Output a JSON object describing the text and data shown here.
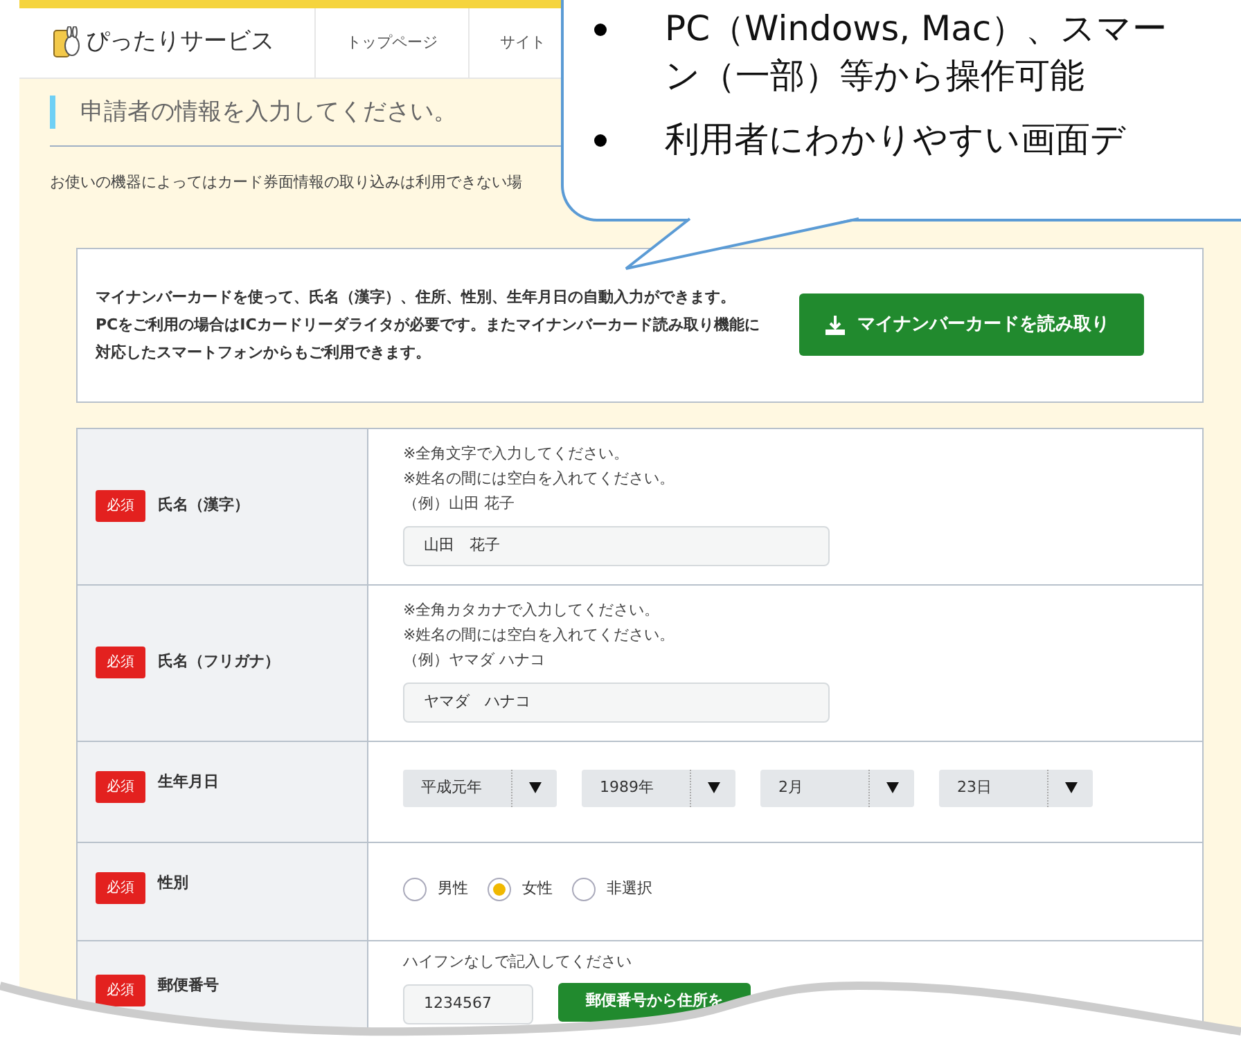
{
  "header": {
    "logo": "ぴったりサービス",
    "nav": [
      "トップページ",
      "サイト"
    ]
  },
  "section_title": "申請者の情報を入力してください。",
  "notice": "お使いの機器によってはカード券面情報の取り込みは利用できない場",
  "card_reader": {
    "paragraphs": [
      "マイナンバーカードを使って、氏名（漢字）、住所、性別、生年月日の自動入力ができます。",
      "PCをご利用の場合はICカードリーダライタが必要です。またマイナンバーカード読み取り機能に対応したスマートフォンからもご利用できます。"
    ],
    "button": "マイナンバーカードを読み取り"
  },
  "form": {
    "rows": [
      {
        "kind": "text",
        "badge": "必須",
        "label": "氏名（漢字）",
        "hints": [
          "※全角文字で入力してください。",
          "※姓名の間には空白を入れてください。",
          "（例）山田 花子"
        ],
        "value": "山田　花子"
      },
      {
        "kind": "text",
        "badge": "必須",
        "label": "氏名（フリガナ）",
        "hints": [
          "※全角カタカナで入力してください。",
          "※姓名の間には空白を入れてください。",
          "（例）ヤマダ ハナコ"
        ],
        "value": "ヤマダ　ハナコ"
      },
      {
        "kind": "date",
        "badge": "必須",
        "label": "生年月日",
        "selects": [
          "平成元年",
          "1989年",
          "2月",
          "23日"
        ]
      },
      {
        "kind": "radio",
        "badge": "必須",
        "label": "性別",
        "options": [
          {
            "label": "男性",
            "selected": false
          },
          {
            "label": "女性",
            "selected": true
          },
          {
            "label": "非選択",
            "selected": false
          }
        ]
      },
      {
        "kind": "postal",
        "badge": "必須",
        "label": "郵便番号",
        "hints": [
          "ハイフンなしで記入してください"
        ],
        "value": "1234567",
        "button": "郵便番号から住所を"
      }
    ]
  },
  "callout": {
    "bullets": [
      {
        "lines": [
          "PC（Windows, Mac）、スマー",
          "ン（一部）等から操作可能"
        ]
      },
      {
        "lines": [
          "利用者にわかりやすい画面デ"
        ]
      }
    ]
  }
}
